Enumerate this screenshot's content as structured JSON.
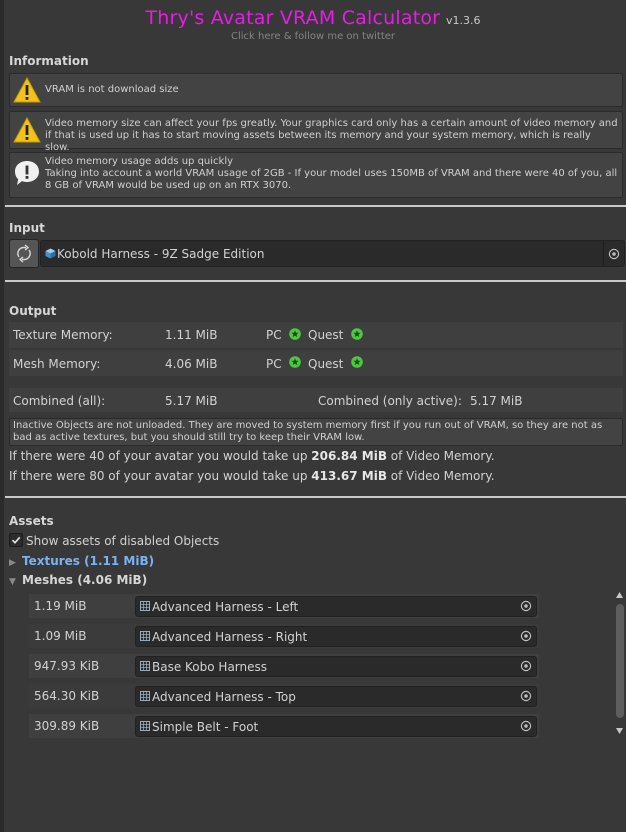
{
  "header": {
    "title": "Thry's Avatar VRAM Calculator",
    "version": "v1.3.6",
    "subtitle": "Click here & follow me on twitter"
  },
  "information": {
    "heading": "Information",
    "boxes": [
      {
        "icon": "warning-icon",
        "text": "VRAM is not download size"
      },
      {
        "icon": "warning-icon",
        "text": "Video memory size can affect your fps greatly. Your graphics card only has a certain amount of video memory and if that is used up it has to start moving assets between its memory and your system memory, which is really slow."
      },
      {
        "icon": "info-icon",
        "text": "Video memory usage adds up quickly\nTaking into account a world VRAM usage of 2GB - If your model uses 150MB of VRAM and there were 40 of you, all 8 GB of VRAM would be used up on an RTX 3070."
      }
    ]
  },
  "input": {
    "heading": "Input",
    "avatar_name": "Kobold Harness - 9Z Sadge Edition"
  },
  "output": {
    "heading": "Output",
    "texture_label": "Texture Memory:",
    "texture_value": "1.11 MiB",
    "mesh_label": "Mesh Memory:",
    "mesh_value": "4.06 MiB",
    "pc_label": "PC",
    "quest_label": "Quest",
    "combined_all_label": "Combined (all):",
    "combined_all_value": "5.17 MiB",
    "combined_active_label": "Combined (only active):",
    "combined_active_value": "5.17 MiB",
    "inactive_note": "Inactive Objects are not unloaded. They are moved to system memory first if you run out of VRAM, so they are not as bad as active textures, but you should still try to keep their VRAM low.",
    "line40_pre": "If there were 40 of your avatar you would take up ",
    "line40_value": "206.84 MiB",
    "line40_post": " of Video Memory.",
    "line80_pre": "If there were 80 of your avatar you would take up ",
    "line80_value": "413.67 MiB",
    "line80_post": " of Video Memory.",
    "status_color": "#4cc93f"
  },
  "assets": {
    "heading": "Assets",
    "show_disabled_label": "Show assets of disabled Objects",
    "show_disabled_checked": true,
    "textures_label": "Textures  (1.11 MiB)",
    "meshes_label": "Meshes  (4.06 MiB)",
    "meshes": [
      {
        "size": "1.19 MiB",
        "name": "Advanced Harness - Left"
      },
      {
        "size": "1.09 MiB",
        "name": "Advanced Harness - Right"
      },
      {
        "size": "947.93 KiB",
        "name": "Base Kobo Harness"
      },
      {
        "size": "564.30 KiB",
        "name": "Advanced Harness - Top"
      },
      {
        "size": "309.89 KiB",
        "name": "Simple Belt - Foot"
      }
    ]
  }
}
